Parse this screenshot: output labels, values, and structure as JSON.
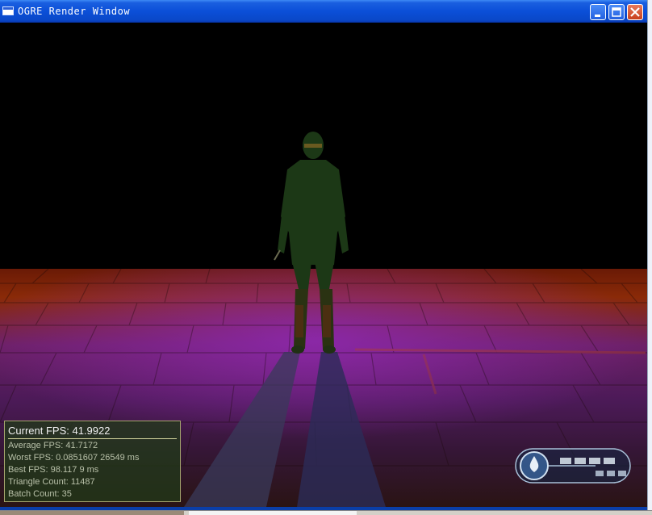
{
  "window": {
    "title": "OGRE Render Window",
    "buttons": {
      "minimize": "minimize-icon",
      "maximize": "maximize-icon",
      "close": "close-icon"
    }
  },
  "stats": {
    "current_fps": "Current  FPS:  41.9922",
    "average_fps": "Average  FPS:  41.7172",
    "worst_fps": "Worst  FPS:  0.0851607  26549  ms",
    "best_fps": "Best  FPS:  98.117  9  ms",
    "triangle_count": "Triangle  Count:  11487",
    "batch_count": "Batch  Count:  35"
  },
  "colors": {
    "titlebar": "#0b4fd8",
    "stats_border": "#a6a66e",
    "floor_red": "#8a2a08",
    "floor_purple": "#6c2066"
  }
}
